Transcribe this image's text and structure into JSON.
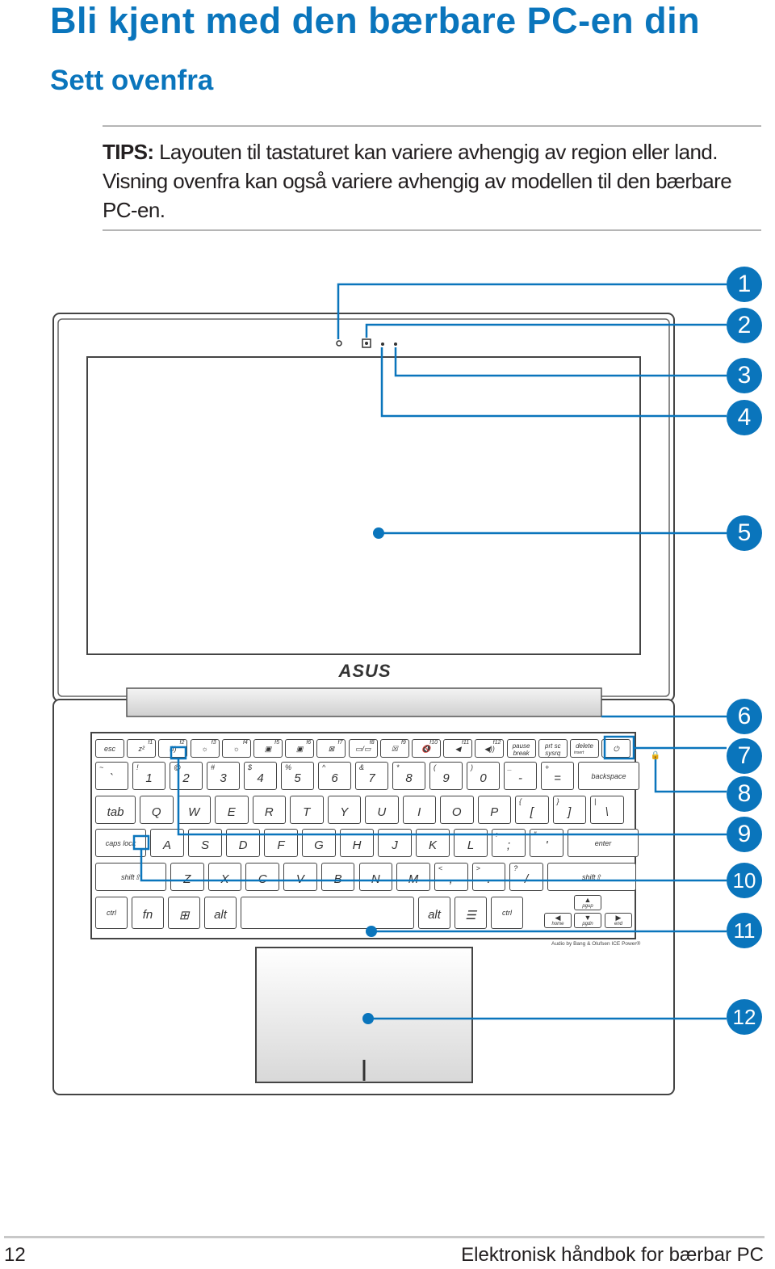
{
  "title": "Bli kjent med den bærbare PC-en din",
  "subtitle": "Sett ovenfra",
  "tips": {
    "label": "TIPS:",
    "text": " Layouten til tastaturet kan variere avhengig av region eller land. Visning ovenfra kan også variere avhengig av modellen til den bærbare PC-en."
  },
  "illustration": {
    "brand_logo": "ASUS",
    "audio_label": "Audio by Bang & Olufsen ICE Power®",
    "callouts": [
      "1",
      "2",
      "3",
      "4",
      "5",
      "6",
      "7",
      "8",
      "9",
      "10",
      "11",
      "12"
    ],
    "accent_color": "#0a75bc",
    "keyboard": {
      "rows": [
        [
          {
            "m": "esc"
          },
          {
            "m": "z²",
            "f": "f1"
          },
          {
            "m": "(ı)",
            "f": "f2"
          },
          {
            "m": "☼",
            "f": "f3"
          },
          {
            "m": "☼",
            "f": "f4"
          },
          {
            "m": "▣",
            "f": "f5"
          },
          {
            "m": "▣",
            "f": "f6"
          },
          {
            "m": "⊠",
            "f": "f7"
          },
          {
            "m": "▭/▭",
            "f": "f8"
          },
          {
            "m": "☒",
            "f": "f9"
          },
          {
            "m": "🔇",
            "f": "f10"
          },
          {
            "m": "◀",
            "f": "f11"
          },
          {
            "m": "◀))",
            "f": "f12"
          },
          {
            "m": "pause break"
          },
          {
            "m": "prt sc sysrq"
          },
          {
            "m": "delete",
            "s2": "insert"
          },
          {
            "m": "⏻"
          }
        ],
        [
          {
            "m": "`",
            "s": "~"
          },
          {
            "m": "1",
            "s": "!"
          },
          {
            "m": "2",
            "s": "@"
          },
          {
            "m": "3",
            "s": "#"
          },
          {
            "m": "4",
            "s": "$"
          },
          {
            "m": "5",
            "s": "%"
          },
          {
            "m": "6",
            "s": "^"
          },
          {
            "m": "7",
            "s": "&"
          },
          {
            "m": "8",
            "s": "*"
          },
          {
            "m": "9",
            "s": "("
          },
          {
            "m": "0",
            "s": ")"
          },
          {
            "m": "-",
            "s": "_"
          },
          {
            "m": "=",
            "s": "+"
          },
          {
            "m": "backspace"
          }
        ],
        [
          {
            "m": "tab"
          },
          {
            "m": "Q"
          },
          {
            "m": "W"
          },
          {
            "m": "E"
          },
          {
            "m": "R"
          },
          {
            "m": "T"
          },
          {
            "m": "Y"
          },
          {
            "m": "U"
          },
          {
            "m": "I"
          },
          {
            "m": "O"
          },
          {
            "m": "P"
          },
          {
            "m": "[",
            "s": "{"
          },
          {
            "m": "]",
            "s": "}"
          },
          {
            "m": "\\",
            "s": "|"
          }
        ],
        [
          {
            "m": "caps lock"
          },
          {
            "m": "A"
          },
          {
            "m": "S"
          },
          {
            "m": "D"
          },
          {
            "m": "F"
          },
          {
            "m": "G"
          },
          {
            "m": "H"
          },
          {
            "m": "J"
          },
          {
            "m": "K"
          },
          {
            "m": "L"
          },
          {
            "m": ";",
            "s": ":"
          },
          {
            "m": "'",
            "s": "\""
          },
          {
            "m": "enter"
          }
        ],
        [
          {
            "m": "shift⇧"
          },
          {
            "m": "Z"
          },
          {
            "m": "X"
          },
          {
            "m": "C"
          },
          {
            "m": "V"
          },
          {
            "m": "B"
          },
          {
            "m": "N"
          },
          {
            "m": "M"
          },
          {
            "m": ",",
            "s": "<"
          },
          {
            "m": ".",
            "s": ">"
          },
          {
            "m": "/",
            "s": "?"
          },
          {
            "m": "shift⇧"
          }
        ],
        [
          {
            "m": "ctrl"
          },
          {
            "m": "fn"
          },
          {
            "m": "⊞"
          },
          {
            "m": "alt"
          },
          {
            "m": ""
          },
          {
            "m": "alt"
          },
          {
            "m": "☰"
          },
          {
            "m": "ctrl"
          }
        ]
      ],
      "arrows": [
        {
          "m": "▲",
          "s": "pgup"
        },
        {
          "m": "◀",
          "s": "home"
        },
        {
          "m": "▼",
          "s": "pgdn"
        },
        {
          "m": "▶",
          "s": "end"
        }
      ]
    }
  },
  "footer": {
    "page_number": "12",
    "text": "Elektronisk håndbok for bærbar PC"
  }
}
